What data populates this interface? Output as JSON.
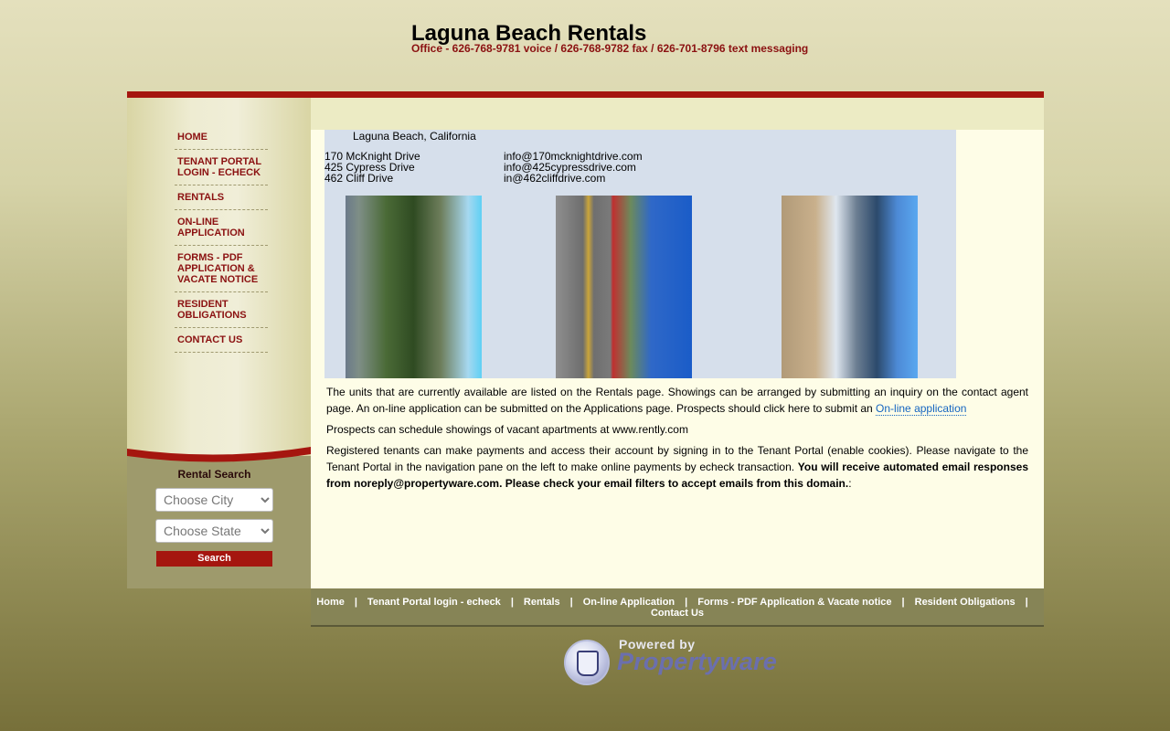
{
  "header": {
    "title": "Laguna Beach Rentals",
    "office": "Office - 626-768-9781 voice / 626-768-9782 fax / 626-701-8796 text messaging"
  },
  "nav": {
    "items": [
      {
        "line1": "HOME",
        "line2": "",
        "line3": ""
      },
      {
        "line1": "TENANT PORTAL",
        "line2": "LOGIN - ECHECK",
        "line3": ""
      },
      {
        "line1": "RENTALS",
        "line2": "",
        "line3": ""
      },
      {
        "line1": "ON-LINE",
        "line2": "APPLICATION",
        "line3": ""
      },
      {
        "line1": "FORMS - PDF",
        "line2": "APPLICATION &",
        "line3": "VACATE NOTICE"
      },
      {
        "line1": "RESIDENT",
        "line2": "OBLIGATIONS",
        "line3": ""
      },
      {
        "line1": "CONTACT US",
        "line2": "",
        "line3": ""
      }
    ]
  },
  "search": {
    "title": "Rental Search",
    "city_placeholder": "Choose City",
    "state_placeholder": "Choose State",
    "button": "Search"
  },
  "main": {
    "city": "Laguna Beach, California",
    "addresses": [
      "170 McKnight Drive",
      "425 Cypress Drive",
      "462 Cliff Drive"
    ],
    "emails": [
      "info@170mcknightdrive.com",
      "info@425cypressdrive.com",
      "in@462cliffdrive.com"
    ],
    "para1": "The units that are currently available are listed on the Rentals page.  Showings can be arranged by submitting an inquiry on the contact agent page.  An on-line application can be submitted on the Applications page.   Prospects should click here to submit an ",
    "para1_link": "On-line application",
    "para2": "Prospects can schedule showings of vacant apartments at www.rently.com",
    "para3": "Registered tenants can make payments and access their account by signing in to the Tenant Portal (enable cookies). Please navigate to the Tenant Portal in the navigation pane on the left to make online payments by echeck transaction.  ",
    "para3_bold": "You will receive automated email responses from noreply@propertyware.com.  Please check your email filters to accept emails from this domain.",
    "para3_end": ":"
  },
  "footer": {
    "links": [
      "Home",
      "Tenant Portal login - echeck",
      "Rentals",
      "On-line Application",
      "Forms - PDF Application & Vacate notice",
      "Resident Obligations",
      "Contact Us"
    ],
    "separator": "|"
  },
  "powered": {
    "by": "Powered by",
    "brand": "Propertyware"
  },
  "colors": {
    "accent": "#a5160f",
    "nav_text": "#8b1111",
    "link": "#1565c0"
  }
}
